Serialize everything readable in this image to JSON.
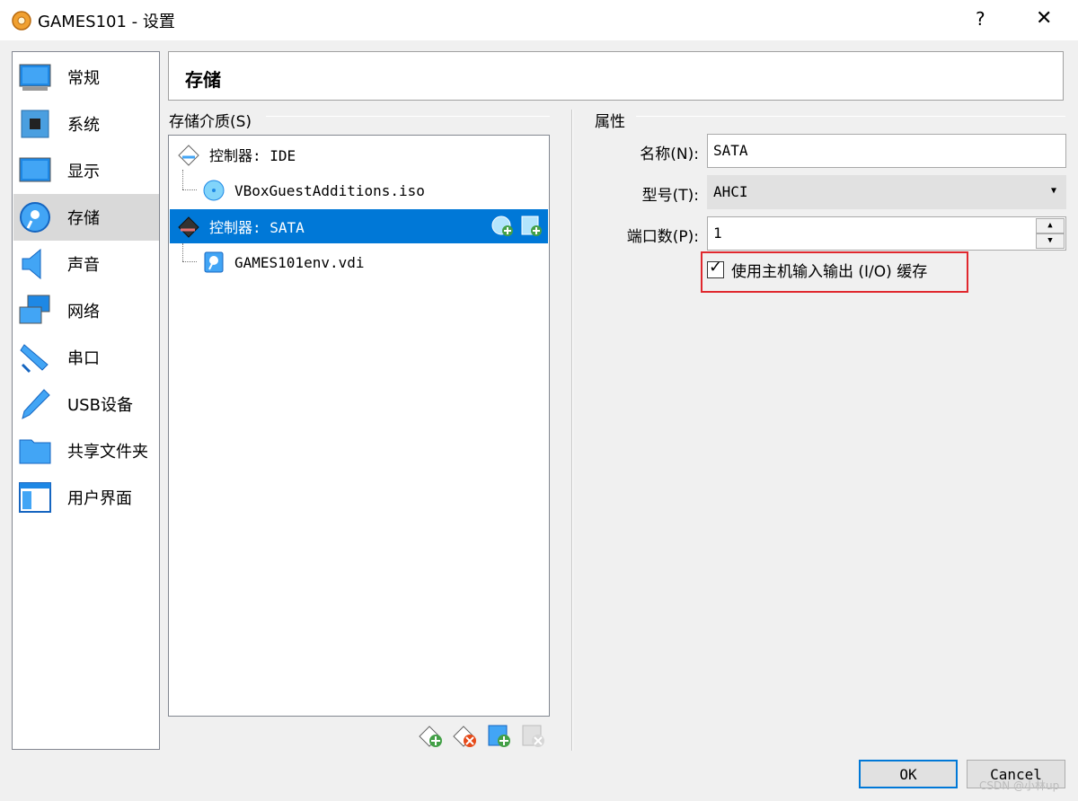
{
  "window": {
    "title": "GAMES101 - 设置",
    "help": "?",
    "close": "✕"
  },
  "sidebar": {
    "items": [
      {
        "label": "常规",
        "icon": "general-icon"
      },
      {
        "label": "系统",
        "icon": "system-icon"
      },
      {
        "label": "显示",
        "icon": "display-icon"
      },
      {
        "label": "存储",
        "icon": "storage-icon",
        "selected": true
      },
      {
        "label": "声音",
        "icon": "audio-icon"
      },
      {
        "label": "网络",
        "icon": "network-icon"
      },
      {
        "label": "串口",
        "icon": "serial-port-icon"
      },
      {
        "label": "USB设备",
        "icon": "usb-icon"
      },
      {
        "label": "共享文件夹",
        "icon": "shared-folder-icon"
      },
      {
        "label": "用户界面",
        "icon": "user-interface-icon"
      }
    ]
  },
  "header": {
    "title": "存储"
  },
  "storage": {
    "group_title": "存储介质(S)",
    "tree": [
      {
        "label": "控制器: IDE",
        "icon": "ide-controller-icon"
      },
      {
        "label": "VBoxGuestAdditions.iso",
        "icon": "optical-disc-icon"
      },
      {
        "label": "控制器: SATA",
        "icon": "sata-controller-icon",
        "selected": true
      },
      {
        "label": "GAMES101env.vdi",
        "icon": "hard-disk-icon"
      }
    ]
  },
  "attributes": {
    "group_title": "属性",
    "name_label": "名称(N):",
    "name_value": "SATA",
    "type_label": "型号(T):",
    "type_value": "AHCI",
    "port_label": "端口数(P):",
    "port_value": "1",
    "host_io_cache_label": "使用主机输入输出 (I/O) 缓存",
    "host_io_cache_checked": true
  },
  "buttons": {
    "ok": "OK",
    "cancel": "Cancel"
  },
  "watermark": "CSDN @小林up",
  "colors": {
    "selection": "#0078d7",
    "highlight_box": "#e0282e"
  }
}
